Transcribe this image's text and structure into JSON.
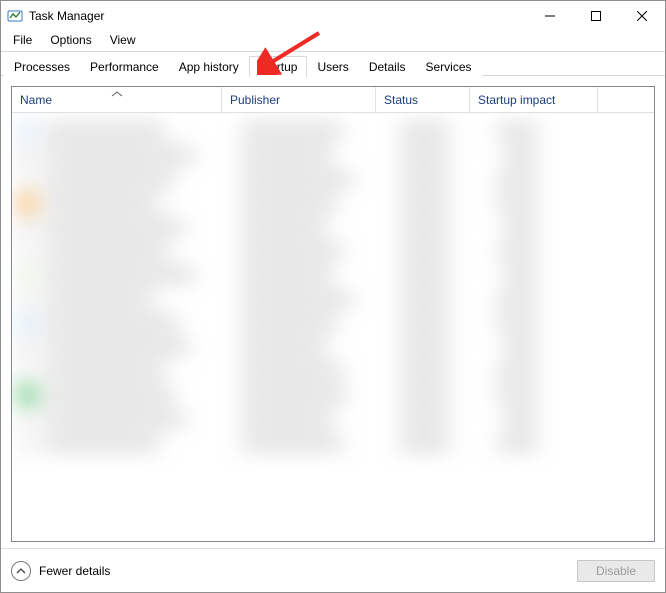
{
  "window": {
    "title": "Task Manager"
  },
  "menu": {
    "file": "File",
    "options": "Options",
    "view": "View"
  },
  "tabs": {
    "processes": "Processes",
    "performance": "Performance",
    "app_history": "App history",
    "startup": "Startup",
    "users": "Users",
    "details": "Details",
    "services": "Services",
    "active": "startup"
  },
  "columns": {
    "name": "Name",
    "publisher": "Publisher",
    "status": "Status",
    "startup_impact": "Startup impact",
    "sorted_by": "name",
    "sort_dir": "asc"
  },
  "footer": {
    "fewer_details": "Fewer details",
    "disable": "Disable",
    "disable_enabled": false
  },
  "annotation": {
    "arrow_points_to": "startup_tab",
    "arrow_color": "#ee2a24"
  }
}
